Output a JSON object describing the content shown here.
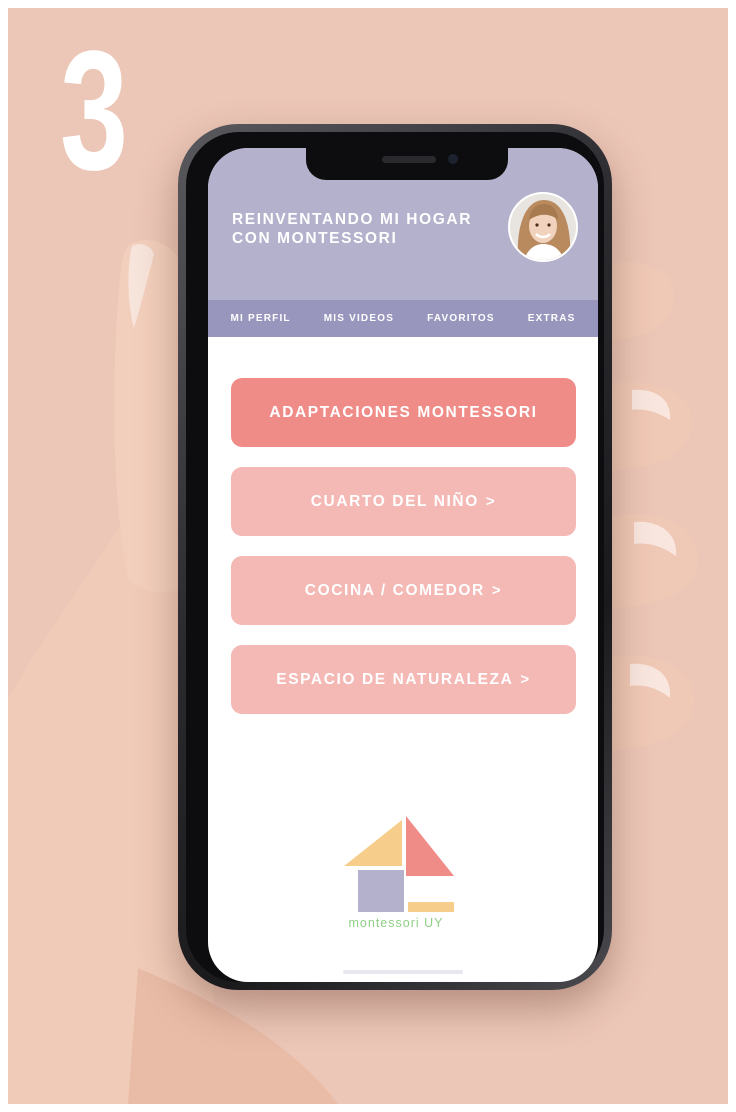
{
  "step": {
    "number": "3"
  },
  "app": {
    "title": "REINVENTANDO MI HOGAR\nCON MONTESSORI",
    "nav": [
      {
        "label": "MI PERFIL"
      },
      {
        "label": "MIS VIDEOS"
      },
      {
        "label": "FAVORITOS"
      },
      {
        "label": "EXTRAS"
      }
    ],
    "menu": [
      {
        "label": "ADAPTACIONES MONTESSORI",
        "chevron": ""
      },
      {
        "label": "CUARTO DEL NIÑO",
        "chevron": ">"
      },
      {
        "label": "COCINA / COMEDOR",
        "chevron": ">"
      },
      {
        "label": "ESPACIO DE NATURALEZA",
        "chevron": ">"
      }
    ],
    "logo": {
      "wordmark": "montessori UY",
      "icon": "montessori-house-logo"
    }
  },
  "icons": {
    "avatar": "profile-photo-avatar",
    "chevron": "chevron-right-icon"
  },
  "colors": {
    "background": "#ecc6b6",
    "header": "#b3b1cb",
    "nav_bar": "#9896bd",
    "primary_button": "#ef8c88",
    "secondary_button": "#f4b8b5",
    "logo_yellow": "#f7cd8c",
    "logo_coral": "#ef8c88",
    "logo_lavender": "#b3b1cb",
    "logo_text": "#8fcf86"
  }
}
